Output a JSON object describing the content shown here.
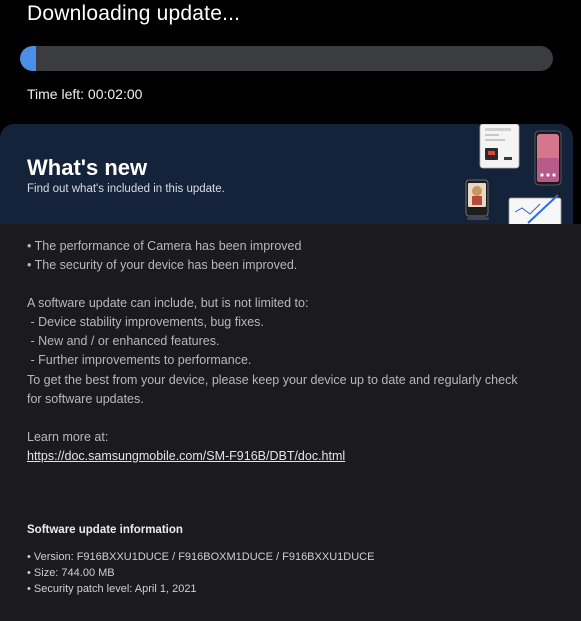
{
  "header": {
    "title": "Downloading update...",
    "time_left": "Time left: 00:02:00",
    "progress": 0.03,
    "progress_color": "#4a8ee8",
    "track_color": "#3a3c40"
  },
  "whats_new": {
    "title": "What's new",
    "subtitle": "Find out what's included in this update.",
    "banner_color": "#15233a"
  },
  "content": {
    "improvements": [
      "• The performance of Camera has been improved",
      "• The security of your device has been improved."
    ],
    "notice_intro": "A software update can include, but is not limited to:",
    "notice_items": [
      " - Device stability improvements, bug fixes.",
      " - New and / or enhanced features.",
      " - Further improvements to performance."
    ],
    "advice_line1": "To get the best from your device, please keep your device up to date and regularly check",
    "advice_line2": "for software updates.",
    "learn_more_label": "Learn more at:",
    "learn_more_url": "https://doc.samsungmobile.com/SM-F916B/DBT/doc.html"
  },
  "update_info": {
    "title": "Software update information",
    "version": "• Version: F916BXXU1DUCE / F916BOXM1DUCE / F916BXXU1DUCE",
    "size": "• Size: 744.00 MB",
    "security_patch": "• Security patch level: April 1, 2021"
  }
}
